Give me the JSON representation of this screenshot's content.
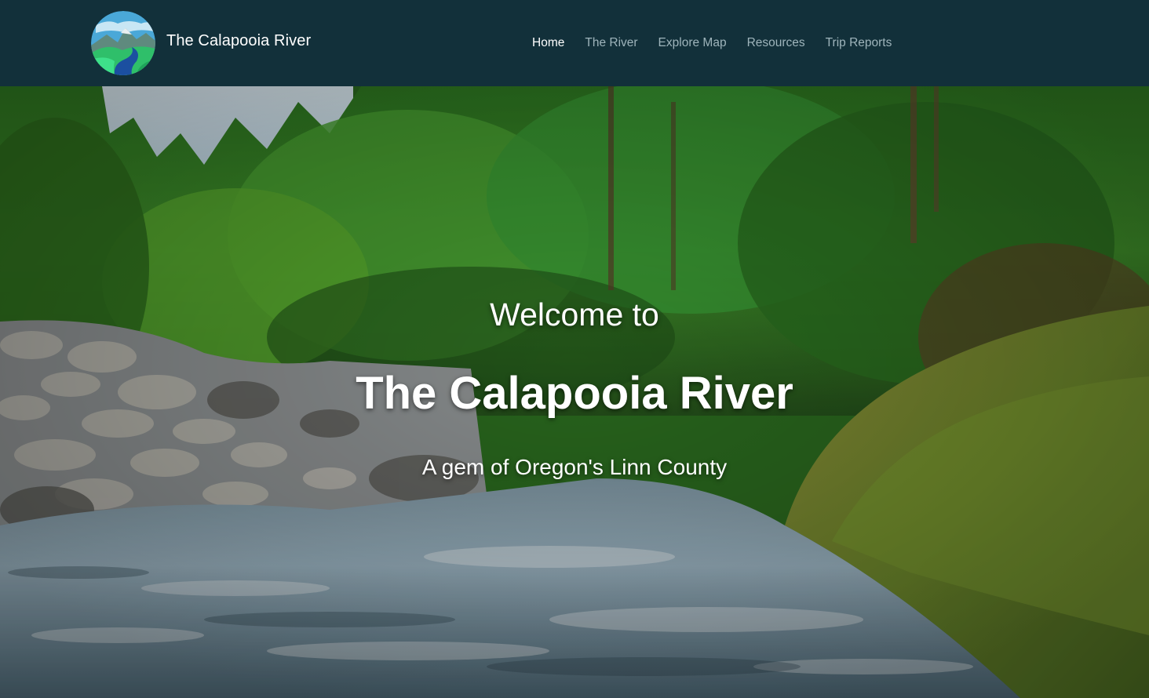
{
  "site": {
    "name": "The Calapooia River",
    "logo_icon": "river-valley-logo-icon"
  },
  "nav": {
    "items": [
      {
        "label": "Home",
        "active": true
      },
      {
        "label": "The River",
        "active": false
      },
      {
        "label": "Explore Map",
        "active": false
      },
      {
        "label": "Resources",
        "active": false
      },
      {
        "label": "Trip Reports",
        "active": false
      }
    ]
  },
  "hero": {
    "pre_title": "Welcome to",
    "title": "The Calapooia River",
    "subtitle": "A gem of Oregon's Linn County"
  },
  "colors": {
    "navbar_bg": "#12303a",
    "nav_active": "#ffffff",
    "nav_inactive": "#9eb4bb"
  }
}
